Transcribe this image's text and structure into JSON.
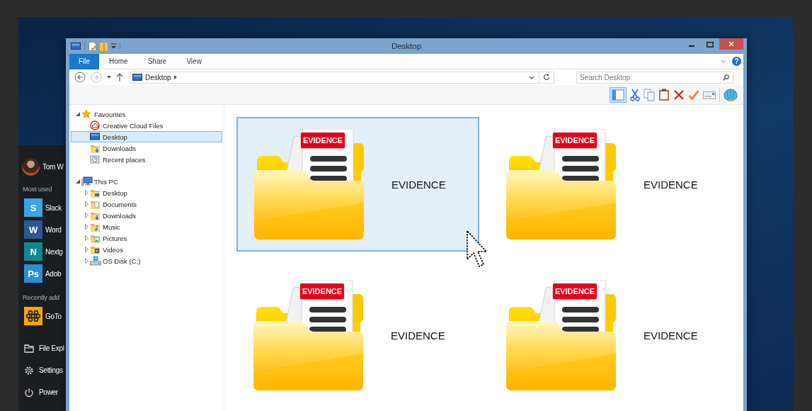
{
  "start_menu": {
    "user": "Tom W",
    "sections": [
      {
        "heading": "Most used",
        "apps": [
          {
            "label": "Slack",
            "glyph": "S",
            "color": "#3aa3e3"
          },
          {
            "label": "Word",
            "glyph": "W",
            "color": "#2b5797"
          },
          {
            "label": "Nextg",
            "glyph": "N",
            "color": "#0e8a8e"
          },
          {
            "label": "Adob",
            "glyph": "Ps",
            "color": "#2a8fd6"
          }
        ]
      },
      {
        "heading": "Recently add",
        "apps": [
          {
            "label": "GoTo",
            "color": "#f6a800"
          }
        ]
      }
    ],
    "places": [
      {
        "kind": "explorer",
        "label": "File Expl"
      },
      {
        "kind": "settings",
        "label": "Settings"
      },
      {
        "kind": "power",
        "label": "Power"
      }
    ]
  },
  "window": {
    "title": "Desktop",
    "tabs": [
      {
        "label": "File",
        "selected": true
      },
      {
        "label": "Home",
        "selected": false
      },
      {
        "label": "Share",
        "selected": false
      },
      {
        "label": "View",
        "selected": false
      }
    ],
    "help": "?",
    "nav_buttons": [
      {
        "kind": "back",
        "disabled": false
      },
      {
        "kind": "forward",
        "disabled": true
      }
    ],
    "address": "Desktop",
    "search": {
      "placeholder": "Search Desktop"
    },
    "navigation": [
      {
        "label": "Favourites",
        "kind": "star",
        "expanded": true,
        "selected": false,
        "children": [
          {
            "label": "Creative Cloud Files",
            "kind": "cloud",
            "selected": false
          },
          {
            "label": "Desktop",
            "kind": "desktop",
            "selected": true
          },
          {
            "label": "Downloads",
            "kind": "downloads",
            "selected": false
          },
          {
            "label": "Recent places",
            "kind": "recent",
            "selected": false
          }
        ]
      },
      {
        "label": "This PC",
        "kind": "pc",
        "expanded": true,
        "selected": false,
        "children": [
          {
            "label": "Desktop",
            "kind": "desktop-folder",
            "expanded": false,
            "selected": false
          },
          {
            "label": "Documents",
            "kind": "documents",
            "expanded": false,
            "selected": false
          },
          {
            "label": "Downloads",
            "kind": "downloads",
            "expanded": false,
            "selected": false
          },
          {
            "label": "Music",
            "kind": "music",
            "expanded": false,
            "selected": false
          },
          {
            "label": "Pictures",
            "kind": "pictures",
            "expanded": false,
            "selected": false
          },
          {
            "label": "Videos",
            "kind": "videos",
            "expanded": false,
            "selected": false
          },
          {
            "label": "OS Disk (C:)",
            "kind": "disk",
            "expanded": false,
            "selected": false
          }
        ]
      }
    ],
    "items": [
      {
        "label": "EVIDENCE",
        "badge": "EVIDENCE",
        "selected": true
      },
      {
        "label": "EVIDENCE",
        "badge": "EVIDENCE",
        "selected": false
      },
      {
        "label": "EVIDENCE",
        "badge": "EVIDENCE",
        "selected": false
      },
      {
        "label": "EVIDENCE",
        "badge": "EVIDENCE",
        "selected": false
      }
    ]
  }
}
